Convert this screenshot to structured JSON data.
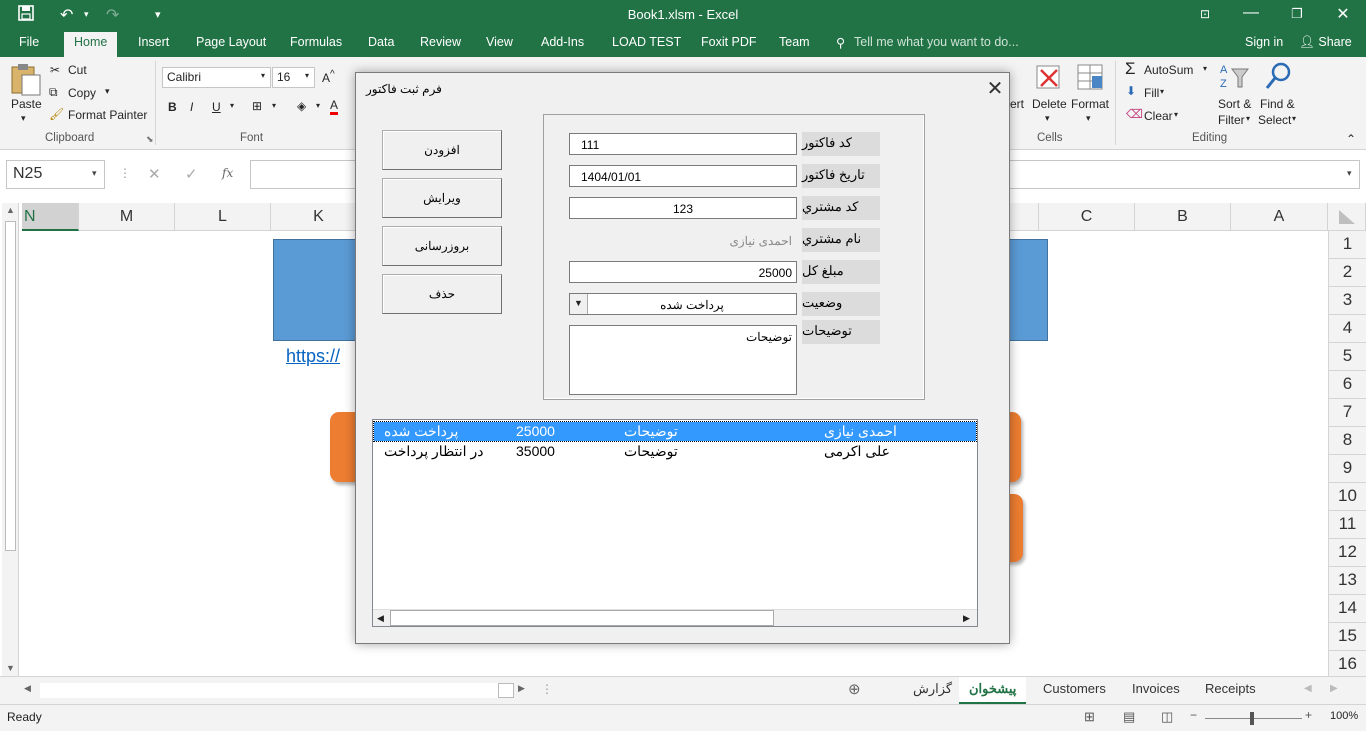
{
  "app": {
    "title": "Book1.xlsm - Excel",
    "accent": "#217346"
  },
  "ribbon_tabs": [
    "File",
    "Home",
    "Insert",
    "Page Layout",
    "Formulas",
    "Data",
    "Review",
    "View",
    "Add-Ins",
    "LOAD TEST",
    "Foxit PDF",
    "Team"
  ],
  "tell_me": "Tell me what you want to do...",
  "sign_in": "Sign in",
  "share": "Share",
  "clipboard": {
    "paste": "Paste",
    "cut": "Cut",
    "copy": "Copy",
    "format_painter": "Format Painter",
    "group": "Clipboard"
  },
  "font": {
    "name": "Calibri",
    "size": "16",
    "group": "Font"
  },
  "cells": {
    "insert_partial": "ert",
    "delete": "Delete",
    "format": "Format",
    "group": "Cells"
  },
  "editing": {
    "autosum": "AutoSum",
    "fill": "Fill",
    "clear": "Clear",
    "sort_filter_1": "Sort &",
    "sort_filter_2": "Filter",
    "find_select_1": "Find &",
    "find_select_2": "Select",
    "group": "Editing"
  },
  "formula_bar": {
    "name_box": "N25",
    "fx": "fx",
    "cancel_icon": "✕",
    "enter_icon": "✓"
  },
  "columns_left": [
    "N",
    "M",
    "L",
    "K"
  ],
  "columns_right": [
    "C",
    "B",
    "A"
  ],
  "rows": [
    "1",
    "2",
    "3",
    "4",
    "5",
    "6",
    "7",
    "8",
    "9",
    "10",
    "11",
    "12",
    "13",
    "14",
    "15",
    "16"
  ],
  "sheet_link_partial": "https://",
  "sheet_tabs": [
    "گزارش",
    "پیشخوان",
    "Customers",
    "Invoices",
    "Receipts"
  ],
  "status": {
    "ready": "Ready",
    "zoom": "100%"
  },
  "dialog": {
    "title": "فرم ثبت فاکتور",
    "buttons": [
      "افزودن",
      "ویرایش",
      "بروزرسانی",
      "حذف"
    ],
    "fields": {
      "invoice_code_label": "کد فاکتور",
      "invoice_code": "111",
      "invoice_date_label": "تاریخ فاکتور",
      "invoice_date": "1404/01/01",
      "customer_code_label": "کد مشتري",
      "customer_code": "123",
      "customer_name_label": "نام مشتري",
      "customer_name": "احمدی نیازی",
      "total_label": "مبلغ کل",
      "total": "25000",
      "status_label": "وضعیت",
      "status": "پرداخت شده",
      "notes_label": "توضیحات",
      "notes": "توضیحات"
    },
    "list": [
      {
        "status": "پرداخت شده",
        "amount": "25000",
        "notes": "توضیحات",
        "name": "احمدی نیازی",
        "selected": true
      },
      {
        "status": "در انتظار پرداخت",
        "amount": "35000",
        "notes": "توضیحات",
        "name": "علی اکرمی",
        "selected": false
      }
    ]
  }
}
